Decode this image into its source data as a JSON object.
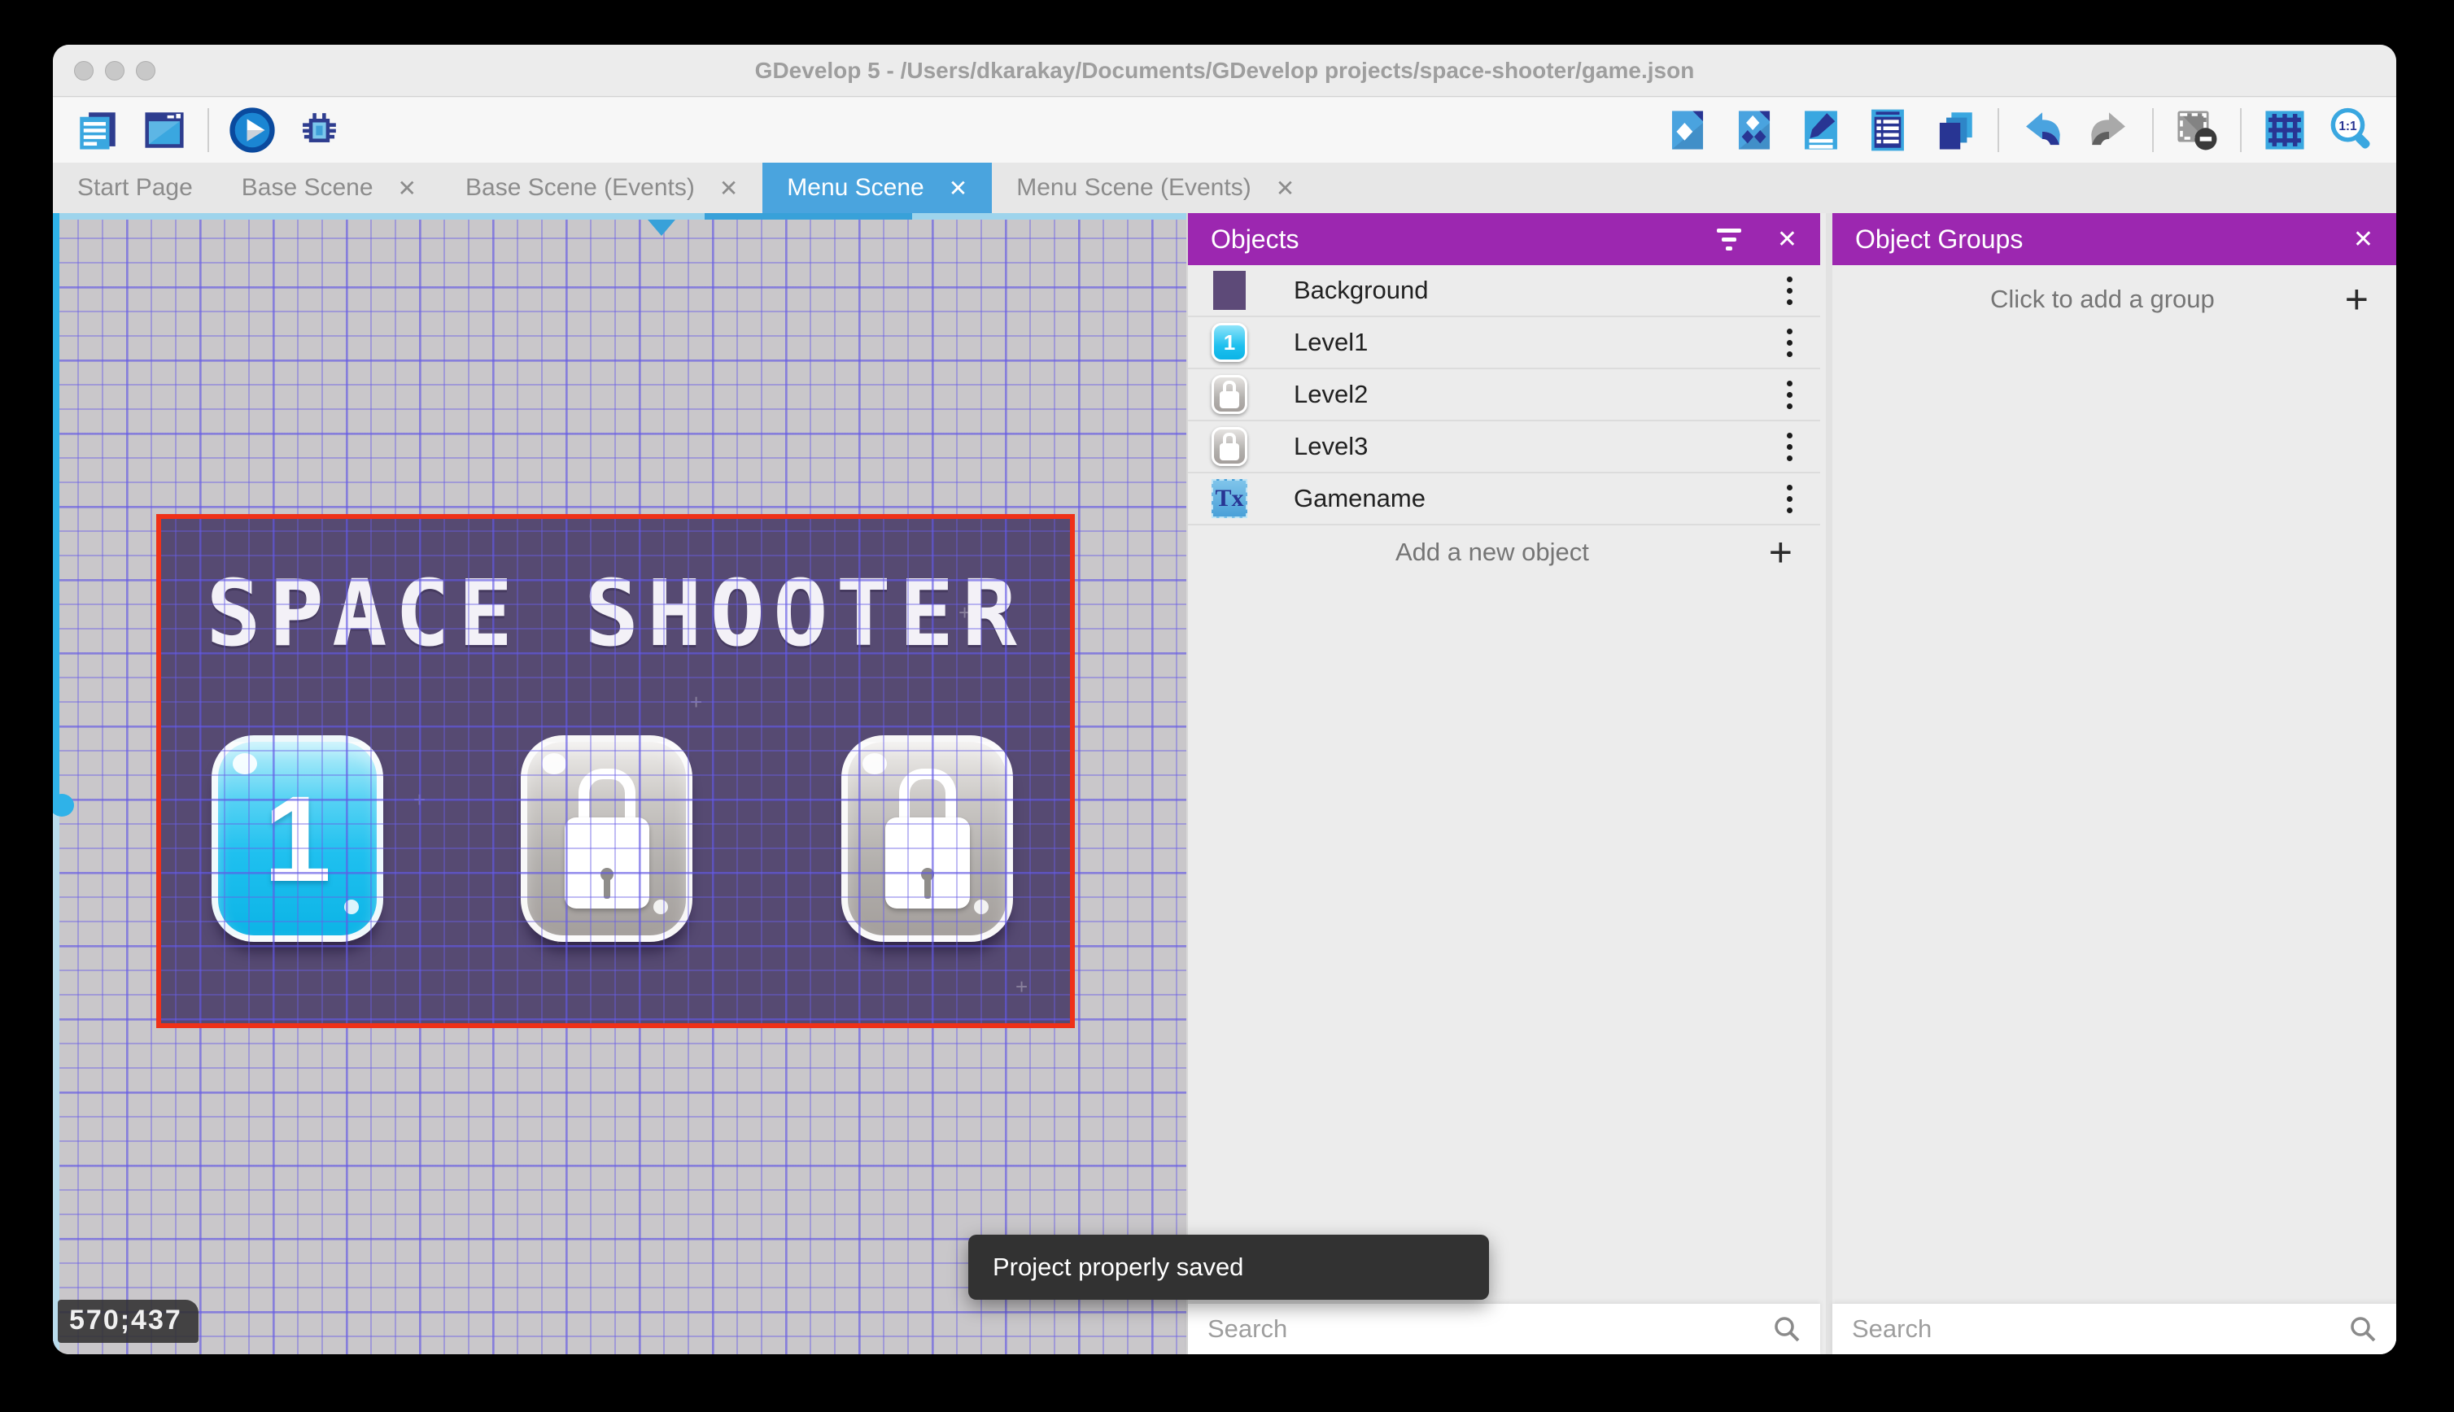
{
  "window": {
    "title": "GDevelop 5 - /Users/dkarakay/Documents/GDevelop projects/space-shooter/game.json"
  },
  "toolbar": {
    "left_icons": [
      "project-manager",
      "scene-window",
      "play",
      "debug"
    ],
    "right_icons": [
      "objects-editor",
      "object-groups-editor",
      "properties",
      "instances-list",
      "layers",
      "undo",
      "redo",
      "mask-render",
      "grid",
      "zoom-1-1"
    ],
    "zoom_label": "1:1"
  },
  "tabs": [
    {
      "label": "Start Page",
      "closable": false,
      "active": false
    },
    {
      "label": "Base Scene",
      "closable": true,
      "active": false
    },
    {
      "label": "Base Scene (Events)",
      "closable": true,
      "active": false
    },
    {
      "label": "Menu Scene",
      "closable": true,
      "active": true
    },
    {
      "label": "Menu Scene (Events)",
      "closable": true,
      "active": false
    }
  ],
  "tab_close_glyph": "✕",
  "canvas": {
    "coordinates": "570;437",
    "scene": {
      "title": "SPACE SHOOTER",
      "buttons": [
        {
          "name": "Level1",
          "label": "1",
          "state": "unlocked"
        },
        {
          "name": "Level2",
          "label": "",
          "state": "locked"
        },
        {
          "name": "Level3",
          "label": "",
          "state": "locked"
        }
      ]
    }
  },
  "objects_panel": {
    "title": "Objects",
    "close_glyph": "✕",
    "items": [
      {
        "label": "Background",
        "thumb": "background"
      },
      {
        "label": "Level1",
        "thumb": "button-1",
        "thumb_label": "1"
      },
      {
        "label": "Level2",
        "thumb": "button-locked"
      },
      {
        "label": "Level3",
        "thumb": "button-locked"
      },
      {
        "label": "Gamename",
        "thumb": "text",
        "thumb_label": "Tx"
      }
    ],
    "add_label": "Add a new object",
    "add_glyph": "+",
    "search_placeholder": "Search"
  },
  "object_groups_panel": {
    "title": "Object Groups",
    "close_glyph": "✕",
    "empty_label": "Click to add a group",
    "add_glyph": "+",
    "search_placeholder": "Search"
  },
  "toast": {
    "message": "Project properly saved"
  },
  "colors": {
    "panel_header": "#9c27b0",
    "active_tab": "#4aa4de",
    "selection_border": "#ef3118",
    "scene_background": "#564a72",
    "button_cyan": "#1fc0ef",
    "canvas_gray": "#c9c7ca"
  }
}
